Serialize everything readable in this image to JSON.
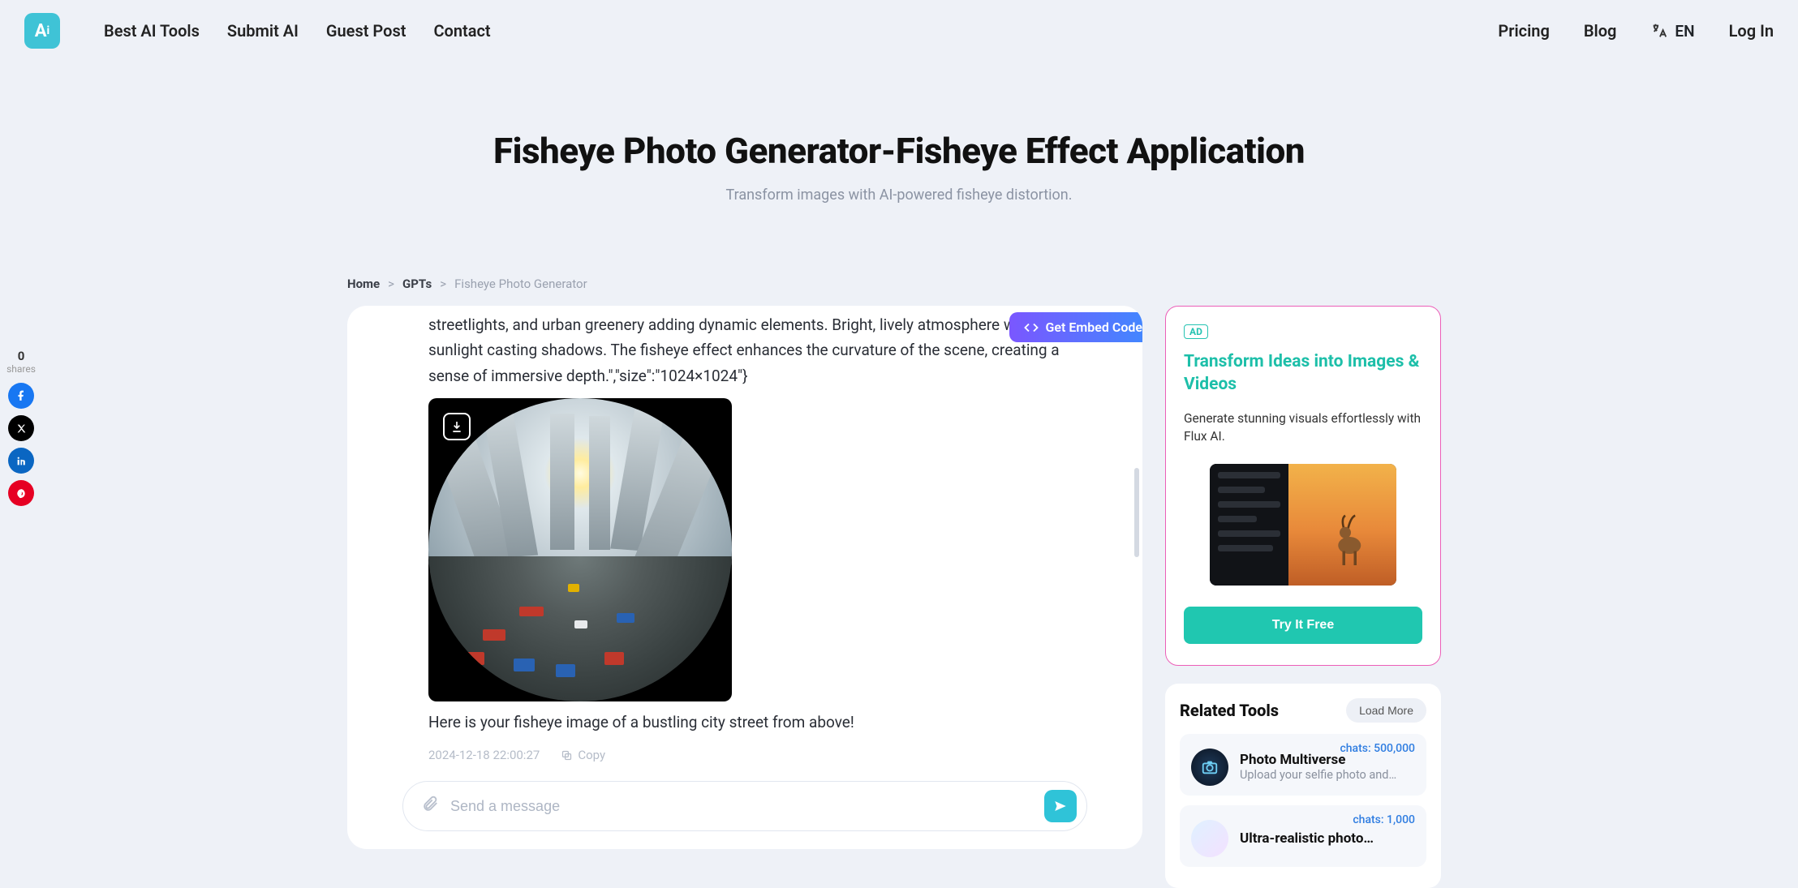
{
  "nav": {
    "left": [
      "Best AI Tools",
      "Submit AI",
      "Guest Post",
      "Contact"
    ],
    "right": [
      "Pricing",
      "Blog"
    ],
    "lang": "EN",
    "login": "Log In"
  },
  "hero": {
    "title": "Fisheye Photo Generator-Fisheye Effect Application",
    "subtitle": "Transform images with AI-powered fisheye distortion."
  },
  "breadcrumb": {
    "home": "Home",
    "mid": "GPTs",
    "current": "Fisheye Photo Generator"
  },
  "embed_label": "Get Embed Code",
  "chat": {
    "body_text": "streetlights, and urban greenery adding dynamic elements. Bright, lively atmosphere with sunlight casting shadows. The fisheye effect enhances the curvature of the scene, creating a sense of immersive depth.\",\"size\":\"1024×1024\"}",
    "caption": "Here is your fisheye image of a bustling city street from above!",
    "timestamp": "2024-12-18 22:00:27",
    "copy": "Copy"
  },
  "input": {
    "placeholder": "Send a message"
  },
  "promo": {
    "badge": "AD",
    "title": "Transform Ideas into Images & Videos",
    "desc": "Generate stunning visuals effortlessly with Flux AI.",
    "cta": "Try It Free"
  },
  "related": {
    "title": "Related Tools",
    "loadmore": "Load More",
    "items": [
      {
        "chats": "chats: 500,000",
        "name": "Photo Multiverse",
        "desc": "Upload your selfie photo and…"
      },
      {
        "chats": "chats: 1,000",
        "name": "Ultra-realistic photo…",
        "desc": ""
      }
    ]
  },
  "share": {
    "count": "0",
    "label": "shares"
  }
}
